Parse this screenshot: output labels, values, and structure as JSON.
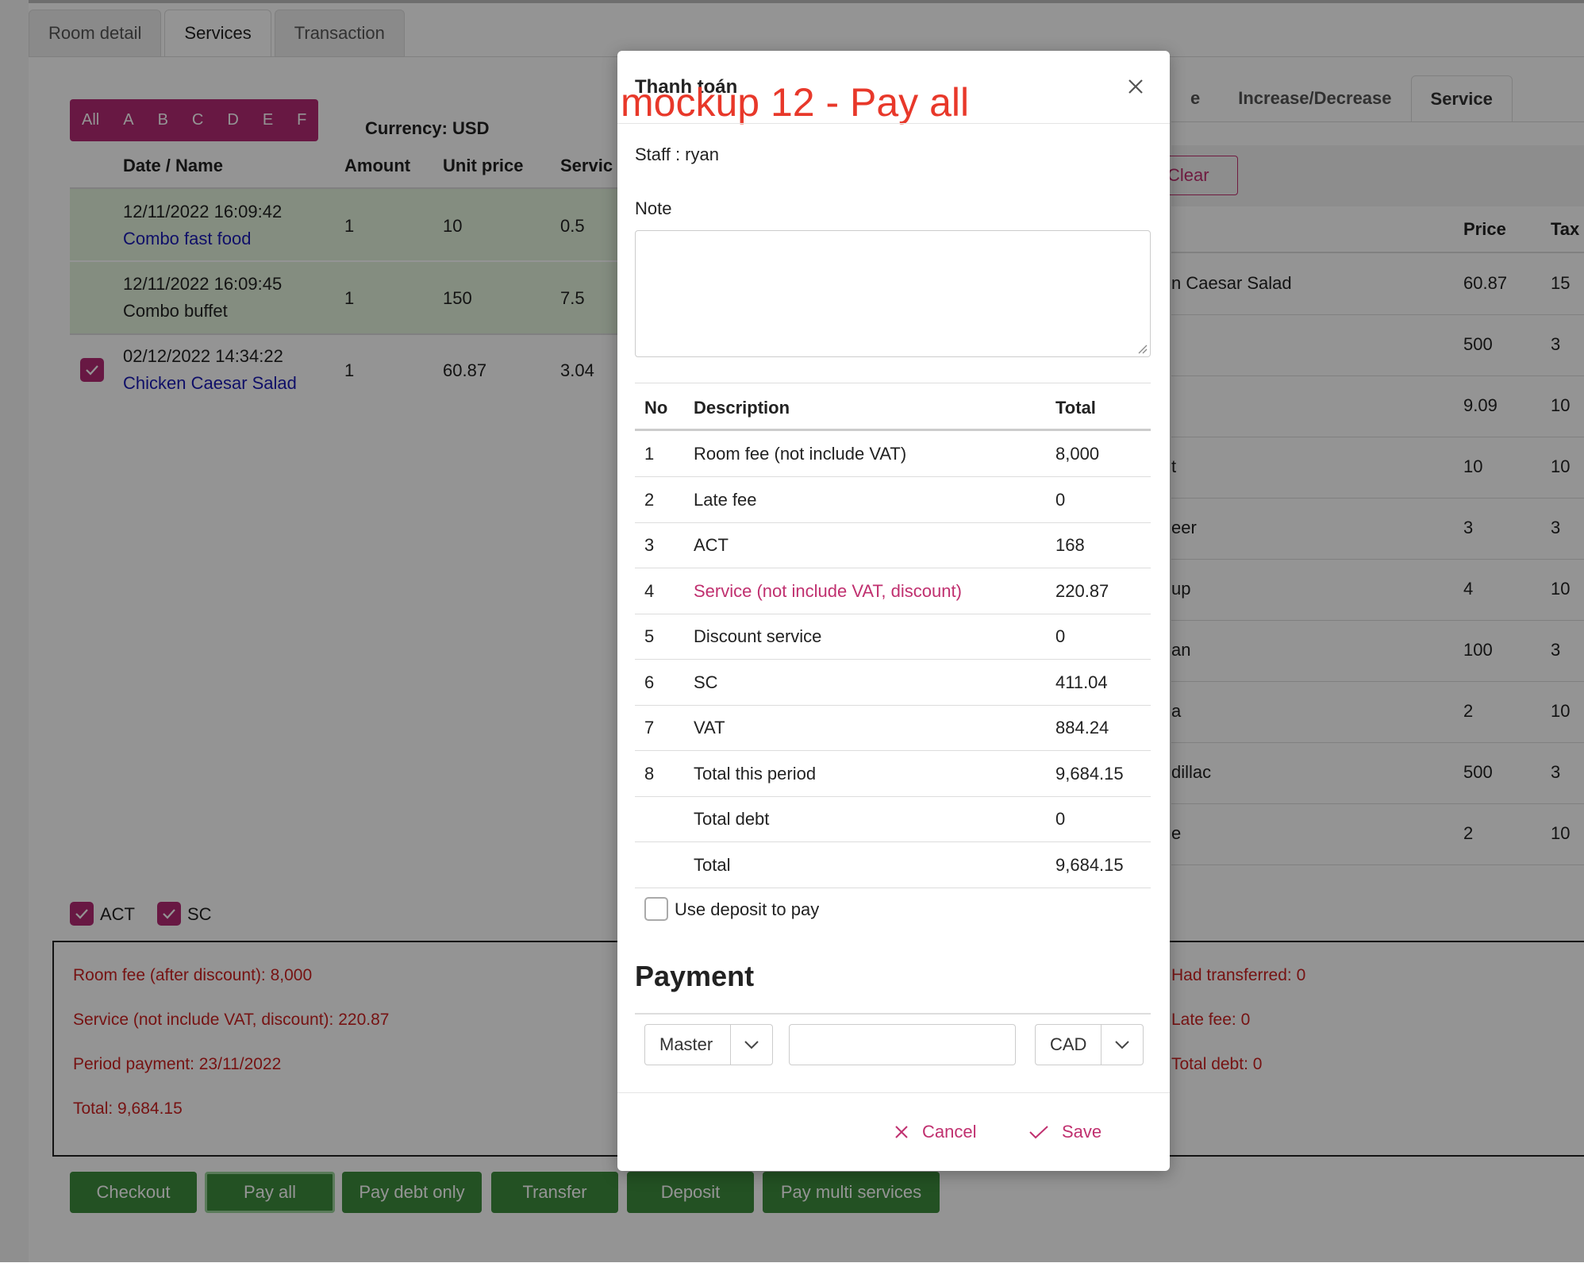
{
  "tabs": [
    "Room detail",
    "Services",
    "Transaction"
  ],
  "filter": [
    "All",
    "A",
    "B",
    "C",
    "D",
    "E",
    "F"
  ],
  "currency": "Currency: USD",
  "left_table": {
    "headers": [
      "Date / Name",
      "Amount",
      "Unit price",
      "Servic"
    ],
    "rows": [
      {
        "date": "12/11/2022 16:09:42",
        "name": "Combo fast food",
        "amount": "1",
        "unit_price": "10",
        "service": "0.5"
      },
      {
        "date": "12/11/2022 16:09:45",
        "name": "Combo buffet",
        "amount": "1",
        "unit_price": "150",
        "service": "7.5"
      },
      {
        "date": "02/12/2022 14:34:22",
        "name": "Chicken Caesar Salad",
        "amount": "1",
        "unit_price": "60.87",
        "service": "3.04"
      }
    ]
  },
  "checks": {
    "act": "ACT",
    "sc": "SC"
  },
  "right_panel": {
    "tabs": [
      "e",
      "Increase/Decrease",
      "Service"
    ],
    "clear": "Clear",
    "headers": {
      "price": "Price",
      "tax": "Tax"
    },
    "rows": [
      {
        "name": "n Caesar Salad",
        "price": "60.87",
        "tax": "15"
      },
      {
        "name": "",
        "price": "500",
        "tax": "3"
      },
      {
        "name": "",
        "price": "9.09",
        "tax": "10"
      },
      {
        "name": "t",
        "price": "10",
        "tax": "10"
      },
      {
        "name": "eer",
        "price": "3",
        "tax": "3"
      },
      {
        "name": "up",
        "price": "4",
        "tax": "10"
      },
      {
        "name": "an",
        "price": "100",
        "tax": "3"
      },
      {
        "name": "a",
        "price": "2",
        "tax": "10"
      },
      {
        "name": "dillac",
        "price": "500",
        "tax": "3"
      },
      {
        "name": "e",
        "price": "2",
        "tax": "10"
      }
    ]
  },
  "summary": {
    "room_fee": "Room fee (after discount): 8,000",
    "service": "Service (not include VAT, discount): 220.87",
    "period": "Period payment: 23/11/2022",
    "total": "Total: 9,684.15",
    "transferred": "Had transferred: 0",
    "late_fee": "Late fee: 0",
    "total_debt": "Total debt: 0"
  },
  "buttons": [
    "Checkout",
    "Pay all",
    "Pay debt only",
    "Transfer",
    "Deposit",
    "Pay multi services"
  ],
  "modal": {
    "title": "Thanh toán",
    "annotation": "mockup 12 - Pay all",
    "staff": "Staff : ryan",
    "note_label": "Note",
    "table_headers": [
      "No",
      "Description",
      "Total"
    ],
    "rows": [
      {
        "no": "1",
        "desc": "Room fee (not include VAT)",
        "total": "8,000"
      },
      {
        "no": "2",
        "desc": "Late fee",
        "total": "0"
      },
      {
        "no": "3",
        "desc": "ACT",
        "total": "168"
      },
      {
        "no": "4",
        "desc": "Service (not include VAT, discount)",
        "total": "220.87"
      },
      {
        "no": "5",
        "desc": "Discount service",
        "total": "0"
      },
      {
        "no": "6",
        "desc": "SC",
        "total": "411.04"
      },
      {
        "no": "7",
        "desc": "VAT",
        "total": "884.24"
      },
      {
        "no": "8",
        "desc": "Total this period",
        "total": "9,684.15"
      },
      {
        "no": "",
        "desc": "Total debt",
        "total": "0"
      },
      {
        "no": "",
        "desc": "Total",
        "total": "9,684.15"
      }
    ],
    "use_deposit": "Use deposit to pay",
    "payment_heading": "Payment",
    "method": "Master",
    "amount_value": "",
    "currency": "CAD",
    "cancel": "Cancel",
    "save": "Save",
    "accent": "#c0306f"
  },
  "colors": {
    "brand": "#b32a74",
    "green": "#3d8c3d",
    "error": "#cc2222",
    "annotation": "#e8382a"
  }
}
